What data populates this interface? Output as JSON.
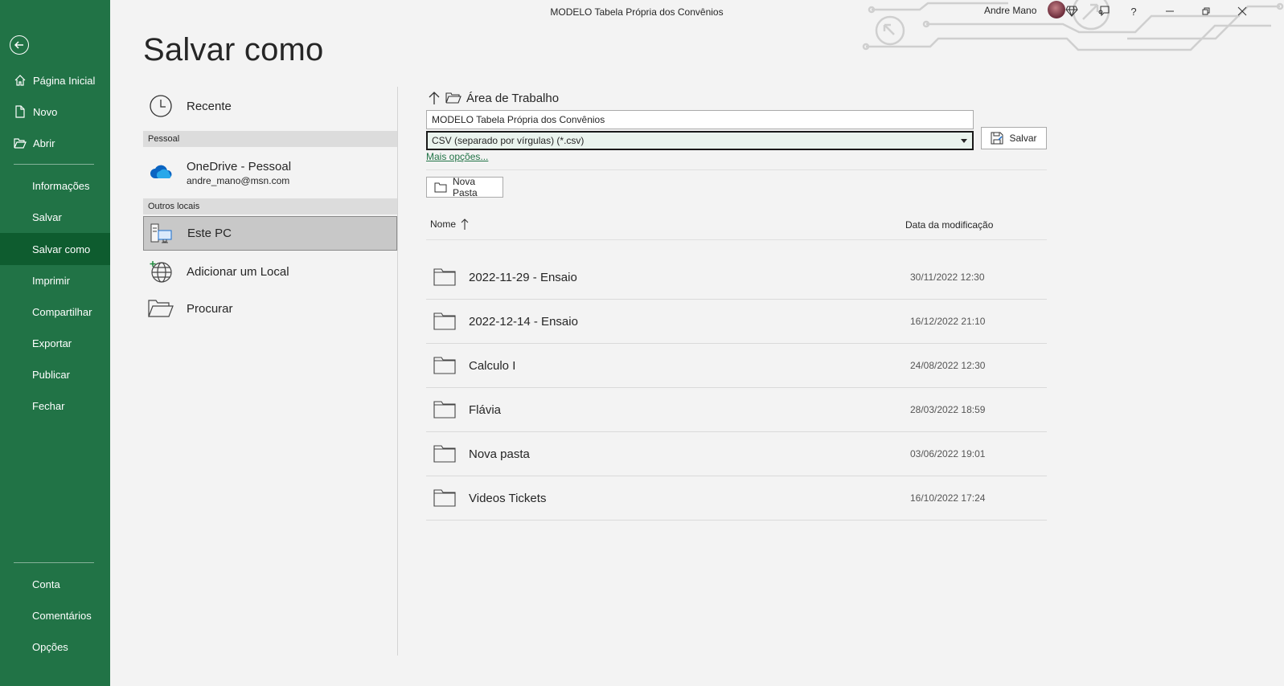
{
  "window": {
    "title": "MODELO Tabela Própria dos Convênios",
    "user_name": "Andre Mano",
    "help_label": "?"
  },
  "nav": {
    "items": [
      {
        "label": "Página Inicial",
        "icon": "home-icon"
      },
      {
        "label": "Novo",
        "icon": "new-document-icon"
      },
      {
        "label": "Abrir",
        "icon": "open-folder-icon"
      },
      {
        "label": "Informações"
      },
      {
        "label": "Salvar"
      },
      {
        "label": "Salvar como"
      },
      {
        "label": "Imprimir"
      },
      {
        "label": "Compartilhar"
      },
      {
        "label": "Exportar"
      },
      {
        "label": "Publicar"
      },
      {
        "label": "Fechar"
      },
      {
        "label": "Conta"
      },
      {
        "label": "Comentários"
      },
      {
        "label": "Opções"
      }
    ]
  },
  "page": {
    "heading": "Salvar como"
  },
  "locations": {
    "recent": "Recente",
    "personal_header": "Pessoal",
    "onedrive_title": "OneDrive - Pessoal",
    "onedrive_email": "andre_mano@msn.com",
    "other_header": "Outros locais",
    "this_pc": "Este PC",
    "add_place": "Adicionar um Local",
    "browse": "Procurar"
  },
  "save": {
    "current_path": "Área de Trabalho",
    "filename": "MODELO Tabela Própria dos Convênios",
    "filetype": "CSV (separado por vírgulas) (*.csv)",
    "save_label": "Salvar",
    "more_options": "Mais opções...",
    "new_folder": "Nova Pasta",
    "col_name": "Nome",
    "col_date": "Data da modificação"
  },
  "files": [
    {
      "name": "2022-11-29 - Ensaio",
      "date": "30/11/2022 12:30"
    },
    {
      "name": "2022-12-14 - Ensaio",
      "date": "16/12/2022 21:10"
    },
    {
      "name": "Calculo I",
      "date": "24/08/2022 12:30"
    },
    {
      "name": "Flávia",
      "date": "28/03/2022 18:59"
    },
    {
      "name": "Nova pasta",
      "date": "03/06/2022 19:01"
    },
    {
      "name": "Videos Tickets",
      "date": "16/10/2022 17:24"
    }
  ],
  "colors": {
    "brand_green": "#217346",
    "nav_active": "#0e5c2f",
    "link_green": "#217346"
  }
}
